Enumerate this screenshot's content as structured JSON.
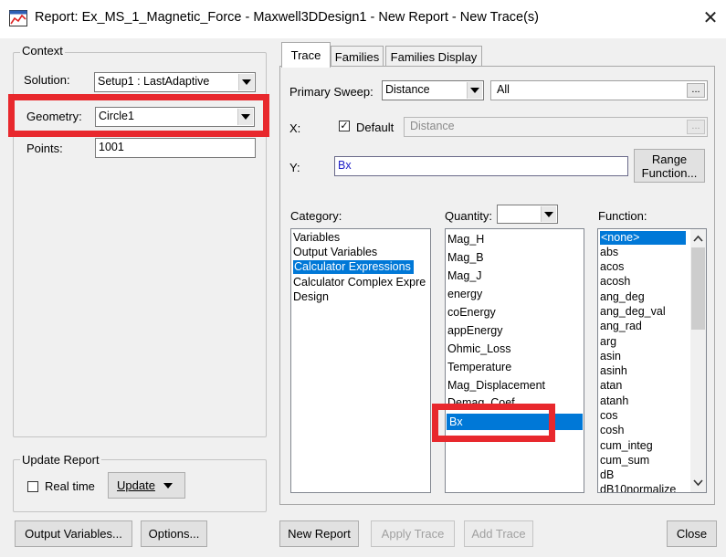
{
  "window": {
    "title": "Report: Ex_MS_1_Magnetic_Force - Maxwell3DDesign1 - New Report - New Trace(s)",
    "close_glyph": "✕",
    "icon": "report-app-icon"
  },
  "context": {
    "legend": "Context",
    "solution_label": "Solution:",
    "solution_value": "Setup1 : LastAdaptive",
    "geometry_label": "Geometry:",
    "geometry_value": "Circle1",
    "points_label": "Points:",
    "points_value": "1001"
  },
  "update_report": {
    "legend": "Update Report",
    "realtime_label": "Real time",
    "realtime_checked": false,
    "update_label": "Update"
  },
  "tabs": [
    {
      "label": "Trace",
      "active": true
    },
    {
      "label": "Families",
      "active": false
    },
    {
      "label": "Families Display",
      "active": false
    }
  ],
  "trace": {
    "primary_sweep_label": "Primary Sweep:",
    "primary_sweep_value": "Distance",
    "sweep_range_value": "All",
    "x_label": "X:",
    "default_label": "Default",
    "default_checked": true,
    "x_value": "Distance",
    "y_label": "Y:",
    "y_value": "Bx",
    "range_function_line1": "Range",
    "range_function_line2": "Function...",
    "ellipsis": "..."
  },
  "category": {
    "label": "Category:",
    "items": [
      "Variables",
      "Output Variables",
      "Calculator Expressions",
      "Calculator Complex Expre",
      "Design"
    ],
    "selected": "Calculator Expressions"
  },
  "quantity": {
    "label": "Quantity:",
    "filter_value": "",
    "items": [
      "Mag_H",
      "Mag_B",
      "Mag_J",
      "energy",
      "coEnergy",
      "appEnergy",
      "Ohmic_Loss",
      "Temperature",
      "Mag_Displacement",
      "Demag_Coef",
      "Bx"
    ],
    "selected": "Bx"
  },
  "function": {
    "label": "Function:",
    "items": [
      "<none>",
      "abs",
      "acos",
      "acosh",
      "ang_deg",
      "ang_deg_val",
      "ang_rad",
      "arg",
      "asin",
      "asinh",
      "atan",
      "atanh",
      "cos",
      "cosh",
      "cum_integ",
      "cum_sum",
      "dB",
      "dB10normalize"
    ],
    "selected": "<none>"
  },
  "buttons": {
    "output_variables": "Output Variables...",
    "options": "Options...",
    "new_report": "New Report",
    "apply_trace": "Apply Trace",
    "add_trace": "Add Trace",
    "close": "Close"
  },
  "colors": {
    "highlight": "#e8282d",
    "selection": "#0078d7",
    "y_text": "#2020c8"
  }
}
